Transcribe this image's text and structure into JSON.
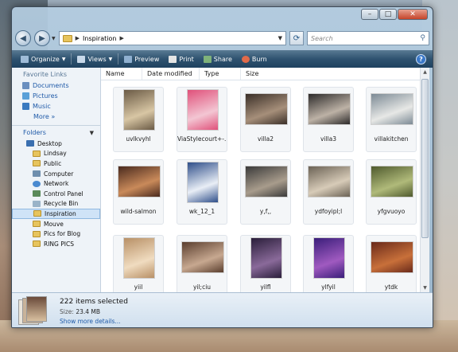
{
  "window": {
    "caption_buttons": {
      "minimize": "–",
      "maximize": "□",
      "close": "✕"
    }
  },
  "address": {
    "path": [
      "Inspiration"
    ],
    "search_placeholder": "Search"
  },
  "toolbar": {
    "items": [
      {
        "label": "Organize",
        "icon": "organize-icon",
        "dropdown": true
      },
      {
        "label": "Views",
        "icon": "views-icon",
        "dropdown": true
      },
      {
        "label": "Preview",
        "icon": "preview-icon"
      },
      {
        "label": "Print",
        "icon": "print-icon"
      },
      {
        "label": "Share",
        "icon": "share-icon"
      },
      {
        "label": "Burn",
        "icon": "burn-icon"
      }
    ],
    "help": "?"
  },
  "nav": {
    "favorite_title": "Favorite Links",
    "favorites": [
      {
        "label": "Documents",
        "color": "#6a8fbf"
      },
      {
        "label": "Pictures",
        "color": "#5aa0d8"
      },
      {
        "label": "Music",
        "color": "#3a7ac0"
      }
    ],
    "more": "More »",
    "folders_title": "Folders",
    "tree": [
      {
        "label": "Desktop",
        "level": 0,
        "icon": "desktop-icon"
      },
      {
        "label": "Lindsay",
        "level": 1,
        "icon": "user-folder-icon"
      },
      {
        "label": "Public",
        "level": 1,
        "icon": "public-folder-icon"
      },
      {
        "label": "Computer",
        "level": 1,
        "icon": "computer-icon"
      },
      {
        "label": "Network",
        "level": 1,
        "icon": "network-icon"
      },
      {
        "label": "Control Panel",
        "level": 1,
        "icon": "control-panel-icon"
      },
      {
        "label": "Recycle Bin",
        "level": 1,
        "icon": "recycle-bin-icon"
      },
      {
        "label": "Inspiration",
        "level": 1,
        "icon": "folder-icon",
        "selected": true
      },
      {
        "label": "Mouve",
        "level": 1,
        "icon": "folder-icon"
      },
      {
        "label": "Pics for Blog",
        "level": 1,
        "icon": "folder-icon"
      },
      {
        "label": "RING PICS",
        "level": 1,
        "icon": "folder-icon"
      }
    ]
  },
  "columns": [
    "Name",
    "Date modified",
    "Type",
    "Size"
  ],
  "files": [
    {
      "name": "uvlkvyhl",
      "colors": [
        "#6a5a45",
        "#d8c6a4"
      ],
      "tall": true
    },
    {
      "name": "ViaStylecourt+-...",
      "colors": [
        "#e0507a",
        "#f3c6d3"
      ],
      "tall": true
    },
    {
      "name": "villa2",
      "colors": [
        "#3a2f28",
        "#a68f7a"
      ]
    },
    {
      "name": "villa3",
      "colors": [
        "#2c2a2a",
        "#bdb2a6"
      ]
    },
    {
      "name": "villakitchen",
      "colors": [
        "#7c8a95",
        "#e7e8e6"
      ]
    },
    {
      "name": "wild-salmon",
      "colors": [
        "#4a2a1e",
        "#c98a5a"
      ]
    },
    {
      "name": "wk_12_1",
      "colors": [
        "#2f4f8a",
        "#e9eef6"
      ],
      "tall": true
    },
    {
      "name": "y,f,,",
      "colors": [
        "#3a3a3a",
        "#a89c8c"
      ]
    },
    {
      "name": "ydfoyipl;l",
      "colors": [
        "#6b6255",
        "#d7cbb8"
      ]
    },
    {
      "name": "yfgvuoyo",
      "colors": [
        "#4f5a2e",
        "#b0ba7a"
      ]
    },
    {
      "name": "yiil",
      "colors": [
        "#b89066",
        "#f0dcc0"
      ],
      "tall": true
    },
    {
      "name": "yil;ciu",
      "colors": [
        "#5a3e2e",
        "#c7a890"
      ]
    },
    {
      "name": "yilfl",
      "colors": [
        "#2a1e3a",
        "#8a6a9a"
      ],
      "tall": true
    },
    {
      "name": "ylfyil",
      "colors": [
        "#3a1e7a",
        "#a05ac0"
      ],
      "tall": true
    },
    {
      "name": "ytdk",
      "colors": [
        "#6a2a1a",
        "#c8703a"
      ]
    }
  ],
  "details": {
    "title": "222 items selected",
    "size_label": "Size:",
    "size_value": "23.4 MB",
    "more": "Show more details..."
  }
}
